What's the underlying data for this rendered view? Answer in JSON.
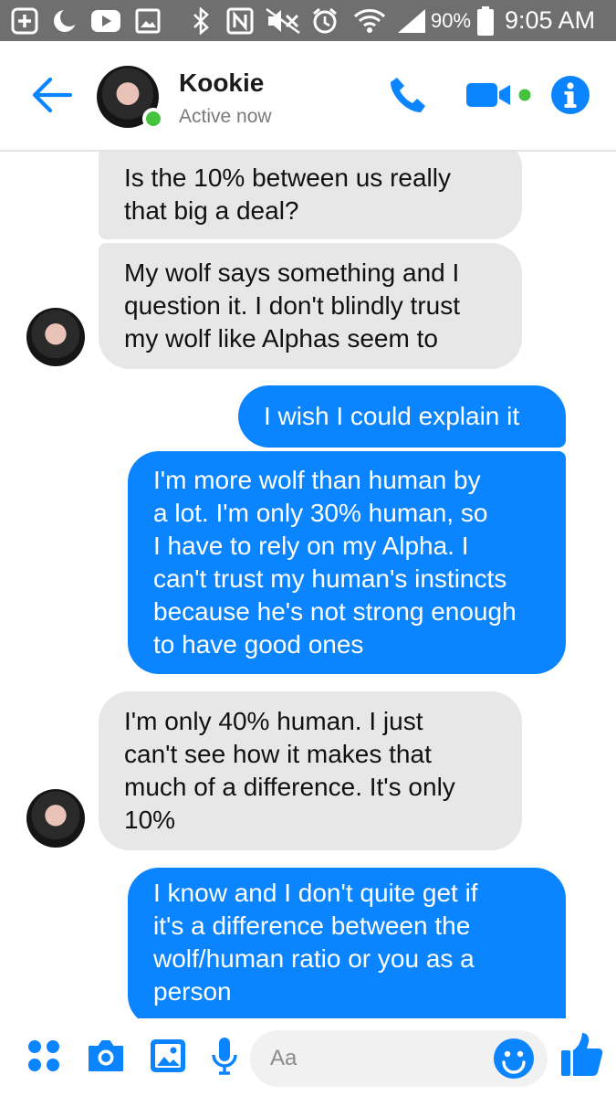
{
  "status_bar": {
    "battery": "90%",
    "time": "9:05 AM",
    "icons": [
      "add-icon",
      "moon-icon",
      "youtube-icon",
      "gallery-icon",
      "bluetooth-icon",
      "nfc-icon",
      "mute-icon",
      "alarm-icon",
      "wifi-icon",
      "signal-icon",
      "battery-icon"
    ]
  },
  "header": {
    "contact_name": "Kookie",
    "status": "Active now",
    "icons": [
      "back-arrow-icon",
      "phone-icon",
      "video-camera-icon",
      "info-icon"
    ]
  },
  "messages": [
    {
      "direction": "in",
      "text": "Is the 10% between us really\nthat big a deal?"
    },
    {
      "direction": "in",
      "text": "My wolf says something and I\nquestion it. I don't blindly trust\nmy wolf like Alphas seem to"
    },
    {
      "direction": "out",
      "text": "I wish I could explain it"
    },
    {
      "direction": "out",
      "text": "I'm more wolf than human by\na lot. I'm only 30% human, so\nI have to rely on my Alpha. I\ncan't trust my human's instincts\nbecause he's not strong enough\nto have good ones"
    },
    {
      "direction": "in",
      "text": "I'm only 40% human. I just\ncan't see how it makes that\nmuch of a difference. It's only\n10%"
    },
    {
      "direction": "out",
      "text": "I know and I don't quite get if\nit's a difference between the\nwolf/human ratio or you as a\nperson"
    }
  ],
  "composer": {
    "placeholder": "Aa",
    "icons": [
      "apps-icon",
      "camera-icon",
      "gallery-icon",
      "microphone-icon",
      "emoji-icon",
      "thumbs-up-icon"
    ]
  },
  "colors": {
    "accent": "#0b84ff",
    "incoming_bubble": "#e7e7e7",
    "online": "#44c33d",
    "status_bar": "#6f6f6f"
  }
}
